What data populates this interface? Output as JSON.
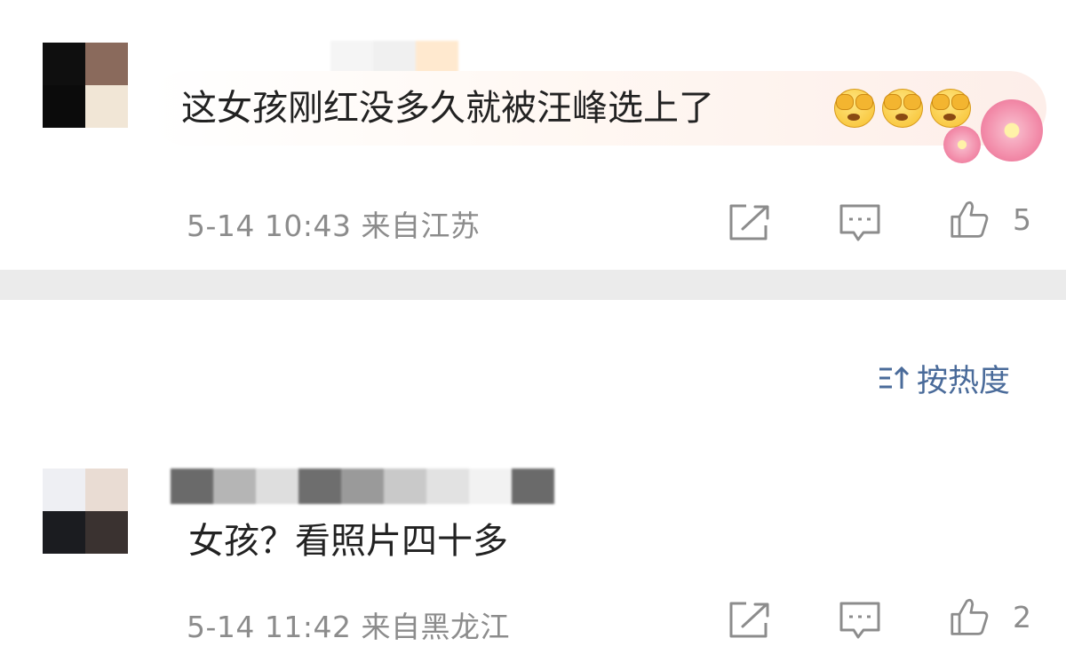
{
  "comments": [
    {
      "avatar_pixels": [
        "#0f0f0f",
        "#8a6a5c",
        "#0b0b0b",
        "#f1e6d6"
      ],
      "username_pixels": [
        "#f5f5f5",
        "#f0f0f0",
        "#ffe9cf"
      ],
      "text": "这女孩刚红没多久就被汪峰选上了",
      "emoji_icons": [
        "see-no-evil-face-icon",
        "see-no-evil-face-icon",
        "see-no-evil-face-icon"
      ],
      "decoration": "flower-icon",
      "time": "5-14 10:43",
      "location": "来自江苏",
      "likes": "5"
    },
    {
      "avatar_pixels": [
        "#eeeff3",
        "#e9dcd3",
        "#1b1c20",
        "#3a3230"
      ],
      "username_pixels": [
        "#6a6a6a",
        "#b5b5b5",
        "#dedede",
        "#6e6e6e",
        "#9a9a9a",
        "#c9c9c9",
        "#e2e2e2",
        "#f2f2f2",
        "#6a6a6a"
      ],
      "text": "女孩？看照片四十多",
      "time": "5-14 11:42",
      "location": "来自黑龙江",
      "likes": "2"
    }
  ],
  "sort": {
    "label": "按热度",
    "icon": "sort-icon"
  },
  "colors": {
    "meta_text": "#8c8c8c",
    "sort_blue": "#4a6b9a",
    "divider": "#ebebeb"
  },
  "icons": {
    "share": "share-icon",
    "comment": "comment-icon",
    "like": "thumbs-up-icon"
  }
}
